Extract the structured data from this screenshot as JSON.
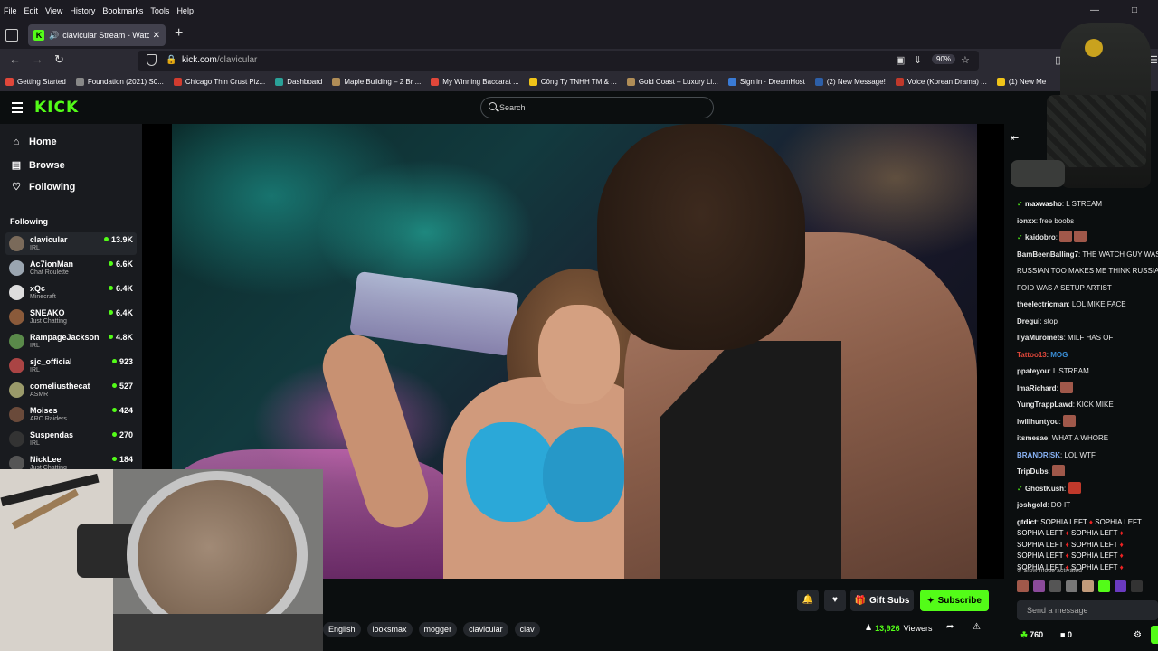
{
  "browser": {
    "menu": [
      "File",
      "Edit",
      "View",
      "History",
      "Bookmarks",
      "Tools",
      "Help"
    ],
    "tab_title": "clavicular Stream - Watch L",
    "url_host": "kick.com",
    "url_path": "/clavicular",
    "zoom": "90%",
    "bookmarks": [
      {
        "label": "Getting Started",
        "color": "#e0473a"
      },
      {
        "label": "Foundation (2021) S0...",
        "color": "#888888"
      },
      {
        "label": "Chicago Thin Crust Piz...",
        "color": "#d23c2f"
      },
      {
        "label": "Dashboard",
        "color": "#2aa198"
      },
      {
        "label": "Maple Building – 2 Br ...",
        "color": "#b08d57"
      },
      {
        "label": "My Winning Baccarat ...",
        "color": "#e0473a"
      },
      {
        "label": "Công Ty TNHH TM & ...",
        "color": "#f0c419"
      },
      {
        "label": "Gold Coast – Luxury Li...",
        "color": "#b08d57"
      },
      {
        "label": "Sign in · DreamHost",
        "color": "#3a7bd5"
      },
      {
        "label": "(2) New Message!",
        "color": "#2d5fa8"
      },
      {
        "label": "Voice (Korean Drama) ...",
        "color": "#c0392b"
      },
      {
        "label": "(1) New Me",
        "color": "#f0c419"
      }
    ]
  },
  "kick": {
    "logo": "KICK",
    "search_placeholder": "Search",
    "nav": [
      {
        "label": "Home",
        "icon": "home-icon"
      },
      {
        "label": "Browse",
        "icon": "browse-icon"
      },
      {
        "label": "Following",
        "icon": "heart-icon"
      }
    ],
    "following_title": "Following",
    "channels": [
      {
        "name": "clavicular",
        "category": "IRL",
        "viewers": "13.9K",
        "color": "#7a6a5a"
      },
      {
        "name": "Ac7ionMan",
        "category": "Chat Roulette",
        "viewers": "6.6K",
        "color": "#9aa5b0"
      },
      {
        "name": "xQc",
        "category": "Minecraft",
        "viewers": "6.4K",
        "color": "#dddddd"
      },
      {
        "name": "SNEAKO",
        "category": "Just Chatting",
        "viewers": "6.4K",
        "color": "#8a5a3a"
      },
      {
        "name": "RampageJackson",
        "category": "IRL",
        "viewers": "4.8K",
        "color": "#5a8a4a"
      },
      {
        "name": "sjc_official",
        "category": "IRL",
        "viewers": "923",
        "color": "#aa4444"
      },
      {
        "name": "corneliusthecat",
        "category": "ASMR",
        "viewers": "527",
        "color": "#9a9a6a"
      },
      {
        "name": "Moises",
        "category": "ARC Raiders",
        "viewers": "424",
        "color": "#6a4a3a"
      },
      {
        "name": "Suspendas",
        "category": "IRL",
        "viewers": "270",
        "color": "#333333"
      },
      {
        "name": "NickLee",
        "category": "Just Chatting",
        "viewers": "184",
        "color": "#555555"
      }
    ],
    "tags": [
      "English",
      "looksmax",
      "mogger",
      "clavicular",
      "clav"
    ],
    "gift_label": "Gift Subs",
    "subscribe_label": "Subscribe",
    "viewer_count": "13,926",
    "viewers_label": "Viewers"
  },
  "chat": {
    "messages": [
      {
        "user": "maxwasho",
        "color": "#ffffff",
        "text": "L STREAM",
        "emotes": 0,
        "badge": true
      },
      {
        "user": "ionxx",
        "color": "#ffffff",
        "text": "free boobs",
        "emotes": 0,
        "badge": false
      },
      {
        "user": "kaidobro",
        "color": "#ffffff",
        "text": "",
        "emotes": 2,
        "badge": true
      },
      {
        "user": "BamBeenBalling7",
        "color": "#ffffff",
        "text": "THE WATCH GUY WAS",
        "emotes": 0,
        "badge": false
      },
      {
        "user": "",
        "color": "#ffffff",
        "text": "RUSSIAN TOO MAKES ME THINK RUSSIAN",
        "emotes": 0,
        "badge": false
      },
      {
        "user": "",
        "color": "#ffffff",
        "text": "FOID WAS A SETUP ARTIST",
        "emotes": 0,
        "badge": false
      },
      {
        "user": "theelectricman",
        "color": "#ffffff",
        "text": "LOL MIKE FACE",
        "emotes": 0,
        "badge": false
      },
      {
        "user": "Dregui",
        "color": "#ffffff",
        "text": "stop",
        "emotes": 0,
        "badge": false
      },
      {
        "user": "IlyaMuromets",
        "color": "#ffffff",
        "text": "MILF HAS OF",
        "emotes": 0,
        "badge": false
      },
      {
        "user": "Tattoo13",
        "color": "#e0473a",
        "text": "MOG",
        "emotes": 0,
        "badge": false
      },
      {
        "user": "ppateyou",
        "color": "#ffffff",
        "text": "L STREAM",
        "emotes": 0,
        "badge": false
      },
      {
        "user": "ImaRichard",
        "color": "#ffffff",
        "text": "",
        "emotes": 1,
        "badge": false
      },
      {
        "user": "YungTrappLawd",
        "color": "#ffffff",
        "text": "KICK MIKE",
        "emotes": 0,
        "badge": false
      },
      {
        "user": "lwillhuntyou",
        "color": "#ffffff",
        "text": "",
        "emotes": 1,
        "badge": false
      },
      {
        "user": "itsmesae",
        "color": "#ffffff",
        "text": "WHAT A WHORE",
        "emotes": 0,
        "badge": false
      },
      {
        "user": "BRANDRISK",
        "color": "#8ab4f8",
        "text": "LOL WTF",
        "emotes": 0,
        "badge": false
      },
      {
        "user": "TripDubs",
        "color": "#ffffff",
        "text": "",
        "emotes": 1,
        "badge": false
      },
      {
        "user": "GhostKush",
        "color": "#ffffff",
        "text": "",
        "emotes": 1,
        "badge": true
      },
      {
        "user": "joshgold",
        "color": "#ffffff",
        "text": "DO IT",
        "emotes": 0,
        "badge": false
      }
    ],
    "spam_user": "gtdict",
    "spam_text": "SOPHIA LEFT",
    "slow_mode": "Slow mode activated",
    "input_placeholder": "Send a message",
    "points": "760",
    "zero": "0"
  }
}
